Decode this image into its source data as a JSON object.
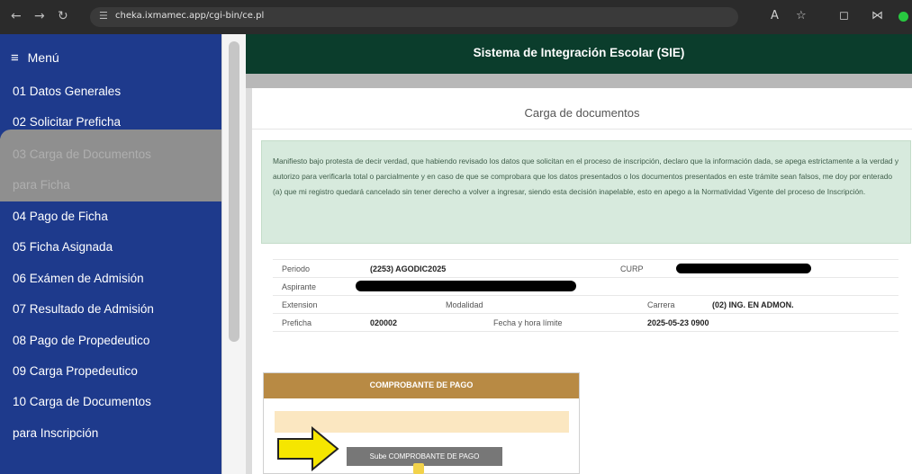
{
  "browser": {
    "url": "cheka.ixmamec.app/cgi-bin/ce.pl",
    "icons": [
      "back-icon",
      "forward-icon",
      "reload-icon",
      "site-info-icon",
      "translate-icon",
      "star-icon",
      "extensions-icon",
      "profile-icon"
    ]
  },
  "sidebar": {
    "menu_label": "Menú",
    "items": [
      {
        "label": "01 Datos Generales"
      },
      {
        "label": "02 Solicitar Preficha"
      },
      {
        "label": "03 Carga de Documentos"
      },
      {
        "label": "para Ficha"
      },
      {
        "label": "04 Pago de Ficha"
      },
      {
        "label": "05 Ficha Asignada"
      },
      {
        "label": "06 Exámen de Admisión"
      },
      {
        "label": "07 Resultado de Admisión"
      },
      {
        "label": "08 Pago de Propedeutico"
      },
      {
        "label": "09 Carga Propedeutico"
      },
      {
        "label": "10 Carga de Documentos"
      },
      {
        "label": "para Inscripción"
      }
    ]
  },
  "header": {
    "title": "Sistema de Integración Escolar (SIE)"
  },
  "main": {
    "section_title": "Carga de documentos",
    "notice": "Manifiesto bajo protesta de decir verdad, que habiendo revisado los datos que solicitan en el proceso de inscripción, declaro que la información dada, se apega estrictamente a la verdad y autorizo para verificarla total o parcialmente y en caso de que se comprobara que los datos presentados o los documentos presentados en este trámite sean falsos, me doy por enterado (a) que mi registro quedará cancelado sin tener derecho a volver a ingresar, siendo esta decisión inapelable, esto en apego a la Normatividad Vigente del proceso de Inscripción.",
    "info": {
      "periodo_label": "Periodo",
      "periodo_value": "(2253) AGODIC2025",
      "curp_label": "CURP",
      "aspirante_label": "Aspirante",
      "extension_label": "Extension",
      "modalidad_label": "Modalidad",
      "carrera_label": "Carrera",
      "carrera_value": "(02) ING. EN ADMON.",
      "preficha_label": "Preficha",
      "preficha_value": "020002",
      "fecha_label": "Fecha y hora límite",
      "fecha_value": "2025-05-23 0900"
    },
    "comprobante": {
      "title": "COMPROBANTE DE PAGO",
      "upload_button": "Sube COMPROBANTE DE PAGO"
    }
  },
  "colors": {
    "sidebar": "#1e3a8c",
    "header": "#0b3d2c",
    "notice_bg": "#d7eadd",
    "card_header": "#b88a44",
    "arrow": "#f5e600"
  }
}
